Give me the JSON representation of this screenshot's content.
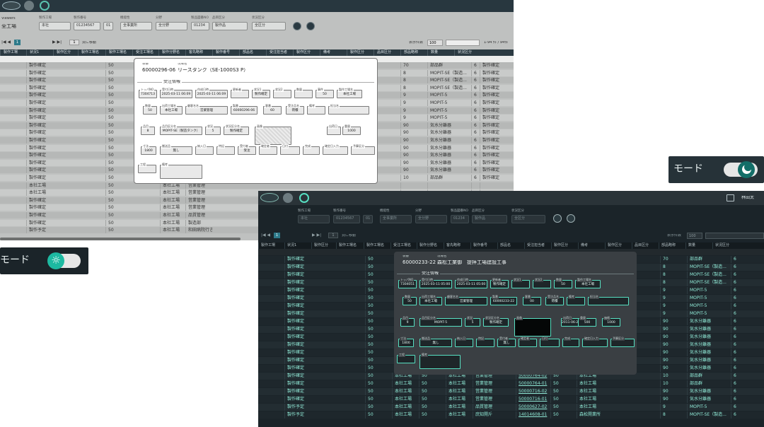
{
  "light": {
    "plant": "全工場",
    "viewing": "Viewers",
    "filters": [
      {
        "label": "製作工場",
        "value": "本社"
      },
      {
        "label": "製作番号",
        "value": "01234567"
      },
      {
        "label": "",
        "value": "01"
      },
      {
        "label": "機能性",
        "value": "全事業所"
      },
      {
        "label": "分野",
        "value": "全分野"
      },
      {
        "label": "製品図番NO",
        "value": "01234"
      },
      {
        "label": "品目区分",
        "value": "製作品"
      },
      {
        "label": "状況区分",
        "value": "全区分"
      }
    ],
    "pager": {
      "page": "1",
      "jump": "頁に移動",
      "show_label": "表示件数",
      "show_value": "100",
      "count": "1-94 件 / 94件"
    },
    "headers": [
      "製作工場",
      "状況1",
      "製作区分",
      "製作工場名",
      "製作工場名",
      "受注工場名",
      "製作分野名",
      "客先略称",
      "製作番号",
      "部品名",
      "受注担当者",
      "製作区分",
      "備考",
      "製作区分",
      "品目区分",
      "部品略称",
      "数量",
      "状況区分"
    ],
    "rows": [
      {
        "a": "製作確定",
        "qty": "50",
        "r1": "70",
        "r2": "部品群",
        "r3": "6",
        "r4": "製作確定"
      },
      {
        "a": "製作確定",
        "qty": "50",
        "r1": "8",
        "r2": "MOPIT-SE（製造...",
        "r3": "6",
        "r4": "製作確定"
      },
      {
        "a": "製作確定",
        "qty": "50",
        "r1": "8",
        "r2": "MOPIT-SE（製造...",
        "r3": "6",
        "r4": "製作確定"
      },
      {
        "a": "製作確定",
        "qty": "50",
        "r1": "8",
        "r2": "MOPIT-SE（製造...",
        "r3": "6",
        "r4": "製作確定"
      },
      {
        "a": "製作確定",
        "qty": "50",
        "r1": "9",
        "r2": "MOPIT-5",
        "r3": "6",
        "r4": "製作確定"
      },
      {
        "a": "製作確定",
        "qty": "50",
        "r1": "9",
        "r2": "MOPIT-5",
        "r3": "6",
        "r4": "製作確定"
      },
      {
        "a": "製作確定",
        "qty": "50",
        "r1": "9",
        "r2": "MOPIT-5",
        "r3": "6",
        "r4": "製作確定"
      },
      {
        "a": "製作確定",
        "qty": "50",
        "r1": "9",
        "r2": "MOPIT-5",
        "r3": "6",
        "r4": "製作確定"
      },
      {
        "a": "製作確定",
        "qty": "50",
        "r1": "90",
        "r2": "気水分離器",
        "r3": "6",
        "r4": "製作確定"
      },
      {
        "a": "製作確定",
        "qty": "50",
        "r1": "90",
        "r2": "気水分離器",
        "r3": "6",
        "r4": "製作確定"
      },
      {
        "a": "製作確定",
        "qty": "50",
        "r1": "90",
        "r2": "気水分離器",
        "r3": "6",
        "r4": "製作確定"
      },
      {
        "a": "製作確定",
        "qty": "50",
        "r1": "90",
        "r2": "気水分離器",
        "r3": "6",
        "r4": "製作確定"
      },
      {
        "a": "製作確定",
        "qty": "50",
        "r1": "90",
        "r2": "気水分離器",
        "r3": "6",
        "r4": "製作確定"
      },
      {
        "a": "製作確定",
        "qty": "50",
        "r1": "90",
        "r2": "気水分離器",
        "r3": "6",
        "r4": "製作確定"
      },
      {
        "a": "製作確定",
        "qty": "50",
        "r1": "90",
        "r2": "気水分離器",
        "r3": "6",
        "r4": "製作確定"
      },
      {
        "a": "製作確定",
        "qty": "50",
        "r1": "10",
        "r2": "部品群",
        "r3": "6",
        "r4": "製作確定"
      },
      {
        "a": "本社工場",
        "qty": "50",
        "c": "本社工場",
        "d": "営業管理",
        "r1": "",
        "r2": "",
        "r3": "",
        "r4": ""
      },
      {
        "a": "本社工場",
        "qty": "50",
        "c": "本社工場",
        "d": "営業管理",
        "r1": "",
        "r2": "",
        "r3": "",
        "r4": ""
      },
      {
        "a": "製作確定",
        "qty": "50",
        "c": "本社工場",
        "d": "営業管理",
        "r1": "",
        "r2": "",
        "r3": "",
        "r4": ""
      },
      {
        "a": "製作確定",
        "qty": "50",
        "c": "本社工場",
        "d": "営業管理",
        "r1": "",
        "r2": "",
        "r3": "",
        "r4": ""
      },
      {
        "a": "製作確定",
        "qty": "50",
        "c": "本社工場",
        "d": "品質管理",
        "r1": "",
        "r2": "",
        "r3": "",
        "r4": ""
      },
      {
        "a": "製作確定",
        "qty": "50",
        "c": "本社工場",
        "d": "製造部",
        "r1": "",
        "r2": "",
        "r3": "",
        "r4": ""
      },
      {
        "a": "製作予定",
        "qty": "50",
        "c": "本社工場",
        "d": "和田病院行き別",
        "r1": "",
        "r2": "",
        "r3": "",
        "r4": ""
      }
    ],
    "modal": {
      "no_label": "製番",
      "no": "60000296-06",
      "name_label": "現場名",
      "name": "リースタンク（SE-1000S3 P）",
      "section": "受注情報",
      "row1": [
        {
          "l": "トッパNO",
          "v": "7304713"
        },
        {
          "l": "受付日時",
          "v": "2025-03-11 06:09"
        },
        {
          "l": "作成日時",
          "v": "2025-03-11 06:09"
        },
        {
          "l": "更新者",
          "v": ""
        },
        {
          "l": "状況1",
          "v": "製作確定"
        },
        {
          "l": "状況2",
          "v": ""
        },
        {
          "l": "数量",
          "v": ""
        },
        {
          "l": "事件",
          "v": "50"
        },
        {
          "l": "製作工場名",
          "v": "本社工場"
        }
      ],
      "row2": [
        {
          "l": "数量",
          "v": "50"
        },
        {
          "l": "出荷工場名",
          "v": "本社工場"
        },
        {
          "l": "顧客名名",
          "v": "営業管理"
        },
        {
          "l": "製番",
          "v": "60000296-06"
        },
        {
          "l": "客番",
          "v": "60"
        },
        {
          "l": "受注品名",
          "v": "荷積"
        },
        {
          "l": "備考",
          "v": ""
        },
        {
          "l": "担当名",
          "v": ""
        }
      ],
      "row3": [
        {
          "l": "品目",
          "v": "8"
        },
        {
          "l": "品目区分名",
          "v": "MOPIT-SE（製造タンク）"
        },
        {
          "l": "状況",
          "v": "5"
        },
        {
          "l": "状況区分名",
          "v": "製作確定"
        },
        {
          "l": "画像",
          "v": ""
        },
        {
          "l": "出荷日",
          "v": ""
        },
        {
          "l": "重量",
          "v": "1000"
        },
        {
          "l": "価格",
          "v": "1000"
        }
      ],
      "row4": [
        {
          "l": "寸法",
          "v": "1800"
        },
        {
          "l": "搬送品",
          "v": "無し"
        },
        {
          "l": "納入日",
          "v": ""
        },
        {
          "l": "特記",
          "v": ""
        },
        {
          "l": "受付者",
          "v": "受注"
        },
        {
          "l": "確定者",
          "v": ""
        },
        {
          "l": "日付",
          "v": ""
        },
        {
          "l": "完成",
          "v": ""
        },
        {
          "l": "確定日入力",
          "v": ""
        },
        {
          "l": "予算区分",
          "v": ""
        }
      ],
      "row5": [
        {
          "l": "工程",
          "v": ""
        },
        {
          "l": "備考",
          "v": ""
        }
      ]
    },
    "toggle_label": "モード"
  },
  "dark": {
    "user": "林田太",
    "filters": [
      {
        "label": "製作工場",
        "value": "本社"
      },
      {
        "label": "製作番号",
        "value": "01234567"
      },
      {
        "label": "",
        "value": "01"
      },
      {
        "label": "機能性",
        "value": "全事業所"
      },
      {
        "label": "分野",
        "value": "全分野"
      },
      {
        "label": "製品図番NO",
        "value": "01234"
      },
      {
        "label": "品目区分",
        "value": "製作品"
      },
      {
        "label": "状況区分",
        "value": "全区分"
      }
    ],
    "pager": {
      "page": "1",
      "jump": "頁に移動",
      "show_label": "表示件数",
      "show_value": "100"
    },
    "rows": [
      {
        "a": "製作確定",
        "qty": "50",
        "r1": "70",
        "r2": "部品群",
        "r3": "6"
      },
      {
        "a": "製作確定",
        "qty": "50",
        "r1": "8",
        "r2": "MOPIT-SE（製造...",
        "r3": "6"
      },
      {
        "a": "製作確定",
        "qty": "50",
        "r1": "8",
        "r2": "MOPIT-SE（製造...",
        "r3": "6"
      },
      {
        "a": "製作確定",
        "qty": "50",
        "r1": "8",
        "r2": "MOPIT-SE（製造...",
        "r3": "6"
      },
      {
        "a": "製作確定",
        "qty": "50",
        "r1": "9",
        "r2": "MOPIT-5",
        "r3": "6"
      },
      {
        "a": "製作確定",
        "qty": "50",
        "r1": "9",
        "r2": "MOPIT-5",
        "r3": "6"
      },
      {
        "a": "製作確定",
        "qty": "50",
        "r1": "9",
        "r2": "MOPIT-5",
        "r3": "6"
      },
      {
        "a": "製作確定",
        "qty": "50",
        "r1": "9",
        "r2": "MOPIT-5",
        "r3": "6"
      },
      {
        "a": "製作確定",
        "qty": "50",
        "r1": "90",
        "r2": "気水分離器",
        "r3": "6"
      },
      {
        "a": "製作確定",
        "qty": "50",
        "r1": "90",
        "r2": "気水分離器",
        "r3": "6"
      },
      {
        "a": "製作確定",
        "qty": "50",
        "r1": "90",
        "r2": "気水分離器",
        "r3": "6"
      },
      {
        "a": "製作確定",
        "qty": "50",
        "r1": "90",
        "r2": "気水分離器",
        "r3": "6"
      },
      {
        "a": "製作確定",
        "qty": "50",
        "r1": "90",
        "r2": "気水分離器",
        "r3": "6"
      },
      {
        "a": "製作確定",
        "qty": "50",
        "r1": "90",
        "r2": "気水分離器",
        "r3": "6"
      },
      {
        "a": "製作確定",
        "qty": "50",
        "r1": "90",
        "r2": "気水分離器",
        "r3": "6"
      },
      {
        "a": "製作確定",
        "qty": "50",
        "c": "本社工場",
        "d": "50",
        "e": "本社工場",
        "f": "営業管理",
        "g": "50000764-02",
        "h": "50",
        "i": "本社工場",
        "r1": "10",
        "r2": "部品群",
        "r3": "6"
      },
      {
        "a": "製作確定",
        "qty": "50",
        "c": "本社工場",
        "d": "50",
        "e": "本社工場",
        "f": "営業管理",
        "g": "50000764-01",
        "h": "50",
        "i": "本社工場",
        "r1": "10",
        "r2": "部品群",
        "r3": "6"
      },
      {
        "a": "製作確定",
        "qty": "50",
        "c": "本社工場",
        "d": "50",
        "e": "本社工場",
        "f": "営業管理",
        "g": "50000716-02",
        "h": "50",
        "i": "本社工場",
        "r1": "90",
        "r2": "気水分離器",
        "r3": "6"
      },
      {
        "a": "製作確定",
        "qty": "50",
        "c": "本社工場",
        "d": "50",
        "e": "本社工場",
        "f": "営業管理",
        "g": "50000716-01",
        "h": "50",
        "i": "本社工場",
        "r1": "90",
        "r2": "気水分離器",
        "r3": "6"
      },
      {
        "a": "製作予定",
        "qty": "50",
        "c": "本社工場",
        "d": "50",
        "e": "本社工場",
        "f": "品質管理",
        "g": "50000627-02",
        "h": "50",
        "i": "本社工場",
        "r1": "9",
        "r2": "MOPIT-5",
        "r3": "6"
      },
      {
        "a": "製作予定",
        "qty": "50",
        "c": "本社工場",
        "d": "50",
        "e": "本社工場",
        "f": "庶知開斤",
        "g": "14014608-01",
        "h": "50",
        "i": "森松開業所",
        "r1": "8",
        "r2": "MOPIT-SE（製造...",
        "r3": "6"
      }
    ],
    "modal": {
      "no_label": "製番",
      "no": "60000233-22",
      "name_label": "現場名",
      "name": "森松工業御　提拝工場建設工事",
      "section": "受注情報",
      "row1": [
        {
          "l": "トッパNO",
          "v": "7304051"
        },
        {
          "l": "受付日時",
          "v": "2025-03-11 05:00"
        },
        {
          "l": "作成日時",
          "v": "2025-03-11 05:00"
        },
        {
          "l": "更新者",
          "v": "製作確定"
        },
        {
          "l": "状況1",
          "v": ""
        },
        {
          "l": "状況2",
          "v": ""
        },
        {
          "l": "数量",
          "v": "50"
        },
        {
          "l": "製作工場名",
          "v": "本社工場"
        }
      ],
      "row2": [
        {
          "l": "数量",
          "v": "50"
        },
        {
          "l": "出荷工場名",
          "v": "本社工場"
        },
        {
          "l": "顧客名名",
          "v": "営業管理"
        },
        {
          "l": "製番",
          "v": "60000233-22"
        },
        {
          "l": "客番",
          "v": "00"
        },
        {
          "l": "受注品名",
          "v": "荷積"
        },
        {
          "l": "備考",
          "v": ""
        },
        {
          "l": "担当名",
          "v": ""
        }
      ],
      "row3": [
        {
          "l": "品目",
          "v": "9"
        },
        {
          "l": "品目区分名",
          "v": "MOPIT-5"
        },
        {
          "l": "状況",
          "v": "5"
        },
        {
          "l": "状況区分名",
          "v": "製作確定"
        },
        {
          "l": "画像",
          "v": ""
        },
        {
          "l": "出荷日",
          "v": "2011-06-29"
        },
        {
          "l": "重量",
          "v": "500"
        },
        {
          "l": "価格",
          "v": "1000"
        }
      ],
      "row4": [
        {
          "l": "寸法",
          "v": "1800"
        },
        {
          "l": "搬送品",
          "v": "無し"
        },
        {
          "l": "納入日",
          "v": ""
        },
        {
          "l": "特記",
          "v": ""
        },
        {
          "l": "受付者",
          "v": "無し"
        },
        {
          "l": "確定者",
          "v": ""
        },
        {
          "l": "日付",
          "v": ""
        },
        {
          "l": "完成",
          "v": ""
        },
        {
          "l": "確定日入力",
          "v": ""
        },
        {
          "l": "予算区分",
          "v": ""
        }
      ],
      "row5": [
        {
          "l": "工程",
          "v": ""
        },
        {
          "l": "備考",
          "v": ""
        }
      ]
    },
    "toggle_label": "モード"
  },
  "colors": {
    "accent": "#57e0c2",
    "dark_bg": "#1b2429",
    "light_bg": "#bfc1c0"
  }
}
